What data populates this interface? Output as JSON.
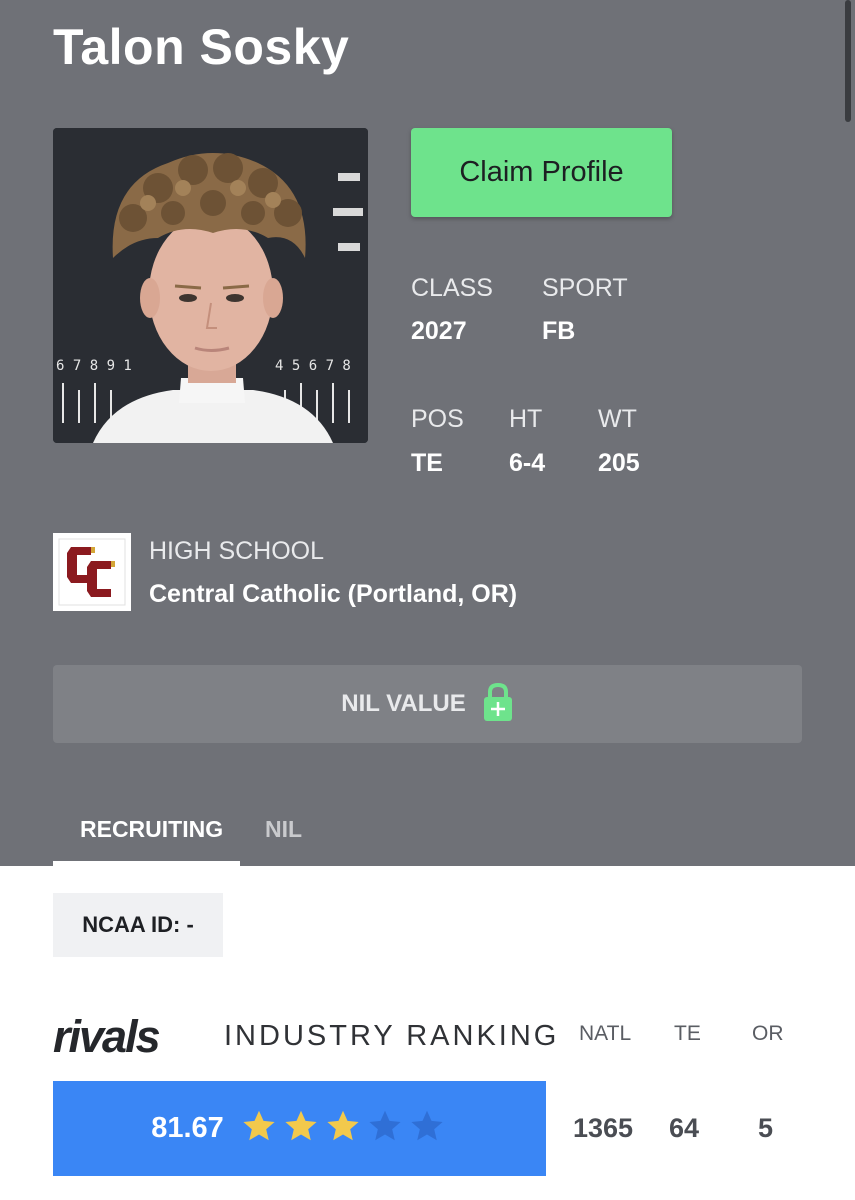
{
  "player": {
    "name": "Talon Sosky"
  },
  "actions": {
    "claim_label": "Claim Profile"
  },
  "stats": {
    "class_label": "CLASS",
    "class_value": "2027",
    "sport_label": "SPORT",
    "sport_value": "FB",
    "pos_label": "POS",
    "pos_value": "TE",
    "ht_label": "HT",
    "ht_value": "6-4",
    "wt_label": "WT",
    "wt_value": "205"
  },
  "school": {
    "label": "HIGH SCHOOL",
    "name": "Central Catholic (Portland, OR)",
    "logo_color": "#8b1a1f"
  },
  "nil": {
    "label": "NIL VALUE",
    "icon": "lock-plus-icon"
  },
  "tabs": [
    {
      "label": "RECRUITING",
      "active": true
    },
    {
      "label": "NIL",
      "active": false
    }
  ],
  "ncaa": {
    "text": "NCAA ID:  -"
  },
  "ranking": {
    "logo_text": "rivals",
    "title": "INDUSTRY RANKING",
    "columns": [
      "NATL",
      "TE",
      "OR"
    ],
    "values": [
      "1365",
      "64",
      "5"
    ],
    "score": "81.67",
    "stars": 3,
    "stars_max": 5
  },
  "colors": {
    "background_top": "#6f7177",
    "claim_button": "#6ee38c",
    "rating_bar": "#3a86f5",
    "star_filled": "#f2c94c",
    "star_empty": "#2f6fd6"
  }
}
